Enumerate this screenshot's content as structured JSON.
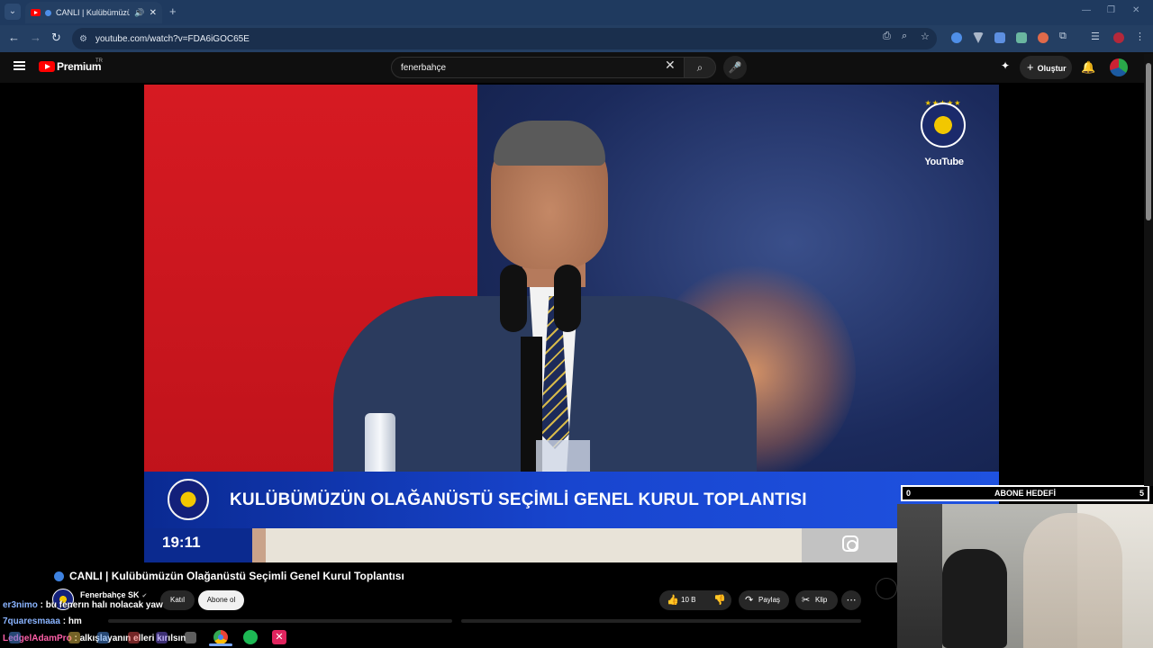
{
  "browser": {
    "tab_title": "CANLI | Kulübümüzün O",
    "new_tab_label": "+",
    "url": "youtube.com/watch?v=FDA6iGOC65E"
  },
  "youtube": {
    "brand": "Premium",
    "country": "TR",
    "search_value": "fenerbahçe",
    "create_label": "Oluştur"
  },
  "video": {
    "watermark": "YouTube",
    "banner_title": "KULÜBÜMÜZÜN OLAĞANÜSTÜ SEÇİMLİ GENEL KURUL TOPLANTISI",
    "clock": "19:11",
    "title": "CANLI | Kulübümüzün Olağanüstü Seçimli Genel Kurul Toplantısı",
    "channel": "Fenerbahçe SK",
    "join_label": "Katıl",
    "subscribe_label": "Abone ol",
    "like_count": "10 B",
    "share_label": "Paylaş",
    "clip_label": "Klip",
    "more_label": "⋯"
  },
  "overlay": {
    "sub_goal_min": "0",
    "sub_goal_label": "ABONE HEDEFİ",
    "sub_goal_max": "5"
  },
  "chat": [
    {
      "user": "er3nimo",
      "message": " : bu fenerın halı nolacak yaw"
    },
    {
      "user": "7quaresmaaa",
      "message": " : hm"
    },
    {
      "user": "LedgelAdamPro",
      "message": " : alkışlayanın elleri kırılsın"
    }
  ],
  "colors": {
    "accent_live": "#3e82e0",
    "youtube_red": "#ff0000",
    "banner_blue": "#1845cf"
  }
}
